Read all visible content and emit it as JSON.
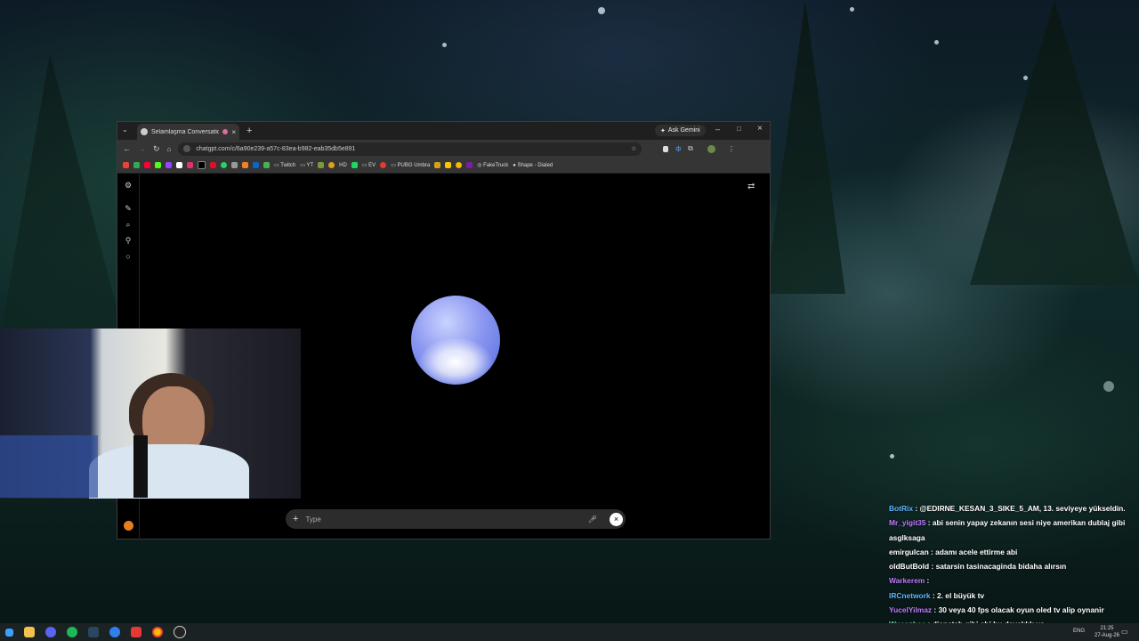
{
  "browser": {
    "tab_title": "Selamlaşma Conversation",
    "ask_gemini": "Ask Gemini",
    "url": "chatgpt.com/c/6a90e239-a57c-83ea-b982-eab35db5e891",
    "bookmarks": [
      "Twitch",
      "YT",
      "HD",
      "EV",
      "PUBG Umbra",
      "FakeTruck",
      "Shape - Dialed"
    ]
  },
  "voice": {
    "input_placeholder": "Type"
  },
  "chat": [
    {
      "user": "BotRix",
      "message": "@EDIRNE_KESAN_3_SIKE_5_AM, 13. seviyeye yükseldin.",
      "color": "#5fb8ff"
    },
    {
      "user": "Mr_yigit35",
      "message": "abi senin yapay zekanın sesi niye amerikan dublaj gibi asglksaga",
      "color": "#c07aff"
    },
    {
      "user": "emirgulcan",
      "message": "adamı acele ettirme abi",
      "color": "#ffffff"
    },
    {
      "user": "oldButBold",
      "message": "satarsin tasinacaginda bidaha alırsın",
      "color": "#ffffff"
    },
    {
      "user": "Warkerem",
      "message": "",
      "color": "#c07aff"
    },
    {
      "user": "IRCnetwork",
      "message": "2. el büyük tv",
      "color": "#5fb8ff"
    },
    {
      "user": "YucelYilmaz",
      "message": "30 veya 40 fps olacak oyun oled tv alip oynanir",
      "color": "#c07aff"
    },
    {
      "user": "Wuenzhaa",
      "message": "dispatch gibi abi bu dayaklık yo",
      "color": "#5fd8a8"
    }
  ],
  "taskbar": {
    "lang": "ENG",
    "time": "21:25",
    "date": "27-Aug-26"
  },
  "colors": {
    "orb": "#8a96f0",
    "browser_chrome": "#353535"
  }
}
